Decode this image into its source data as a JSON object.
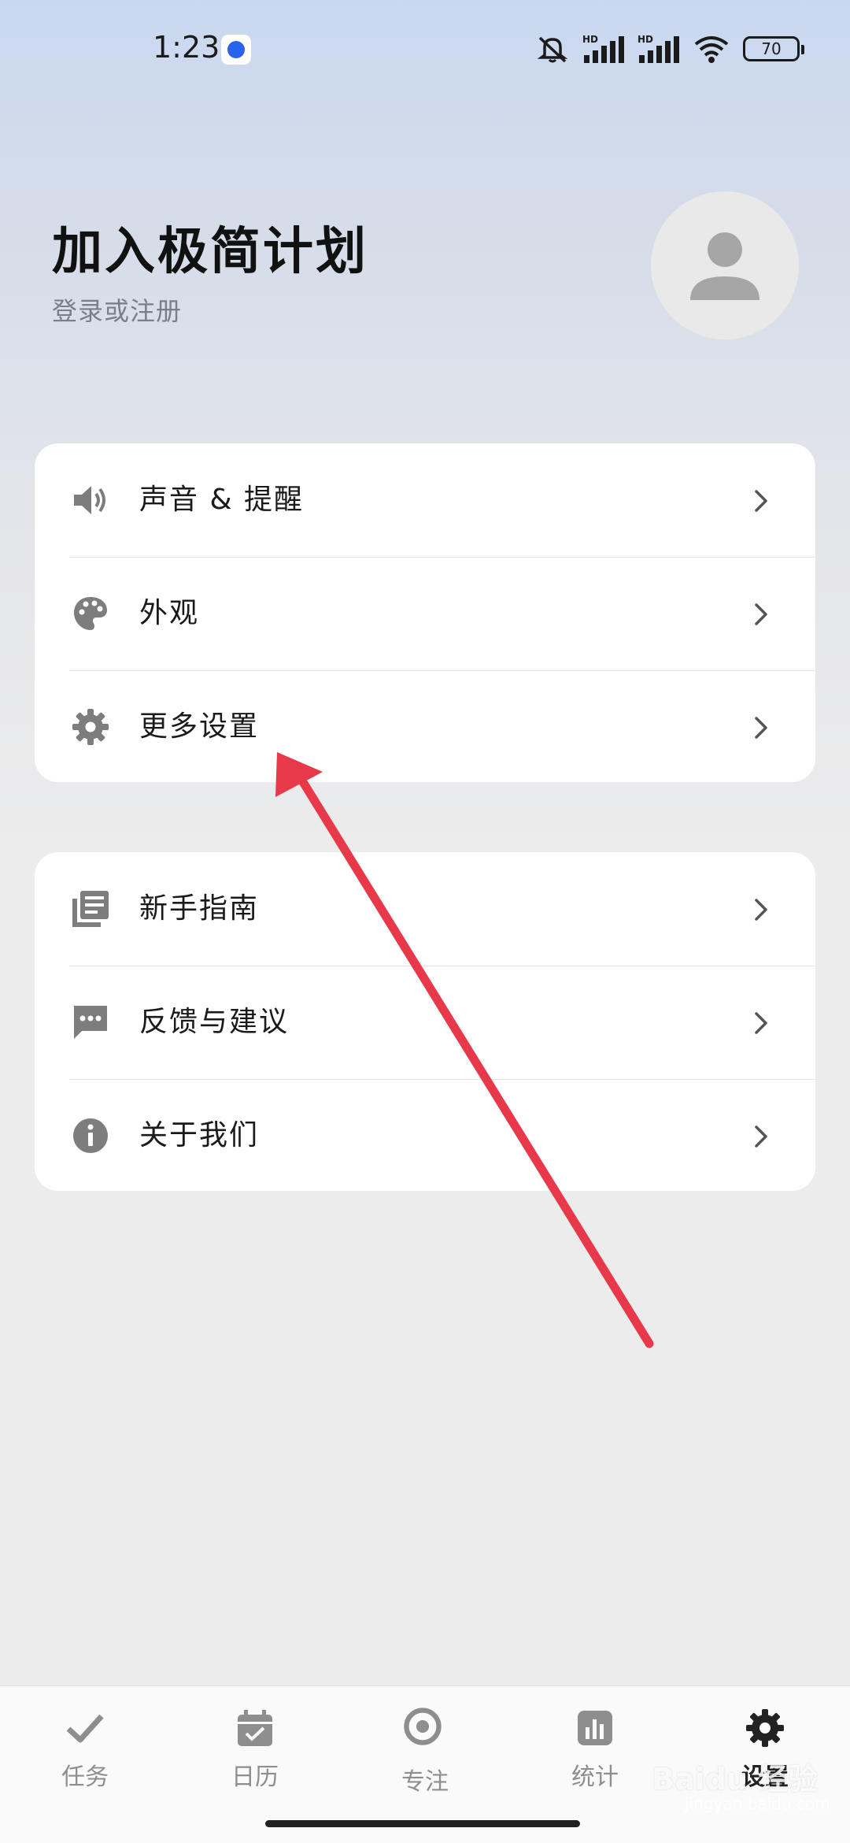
{
  "status_bar": {
    "time": "1:23",
    "battery": "70",
    "signal_1_label": "HD",
    "signal_2_label": "HD"
  },
  "header": {
    "title": "加入极简计划",
    "subtitle": "登录或注册"
  },
  "settings_group_1": [
    {
      "label": "声音 & 提醒",
      "icon": "speaker-icon"
    },
    {
      "label": "外观",
      "icon": "palette-icon"
    },
    {
      "label": "更多设置",
      "icon": "gear-icon"
    }
  ],
  "settings_group_2": [
    {
      "label": "新手指南",
      "icon": "guide-icon"
    },
    {
      "label": "反馈与建议",
      "icon": "feedback-icon"
    },
    {
      "label": "关于我们",
      "icon": "info-icon"
    }
  ],
  "bottom_nav": [
    {
      "label": "任务",
      "icon": "check-icon",
      "active": false
    },
    {
      "label": "日历",
      "icon": "calendar-icon",
      "active": false
    },
    {
      "label": "专注",
      "icon": "focus-icon",
      "active": false
    },
    {
      "label": "统计",
      "icon": "stats-icon",
      "active": false
    },
    {
      "label": "设置",
      "icon": "gear-icon",
      "active": true
    }
  ],
  "watermark": {
    "brand": "Baidu 经验",
    "url": "jingyan.baidu.com"
  },
  "colors": {
    "icon_gray": "#7d7d7d",
    "annotation_red": "#e8394a",
    "nav_inactive": "#8e8e8e",
    "nav_active": "#222222"
  }
}
